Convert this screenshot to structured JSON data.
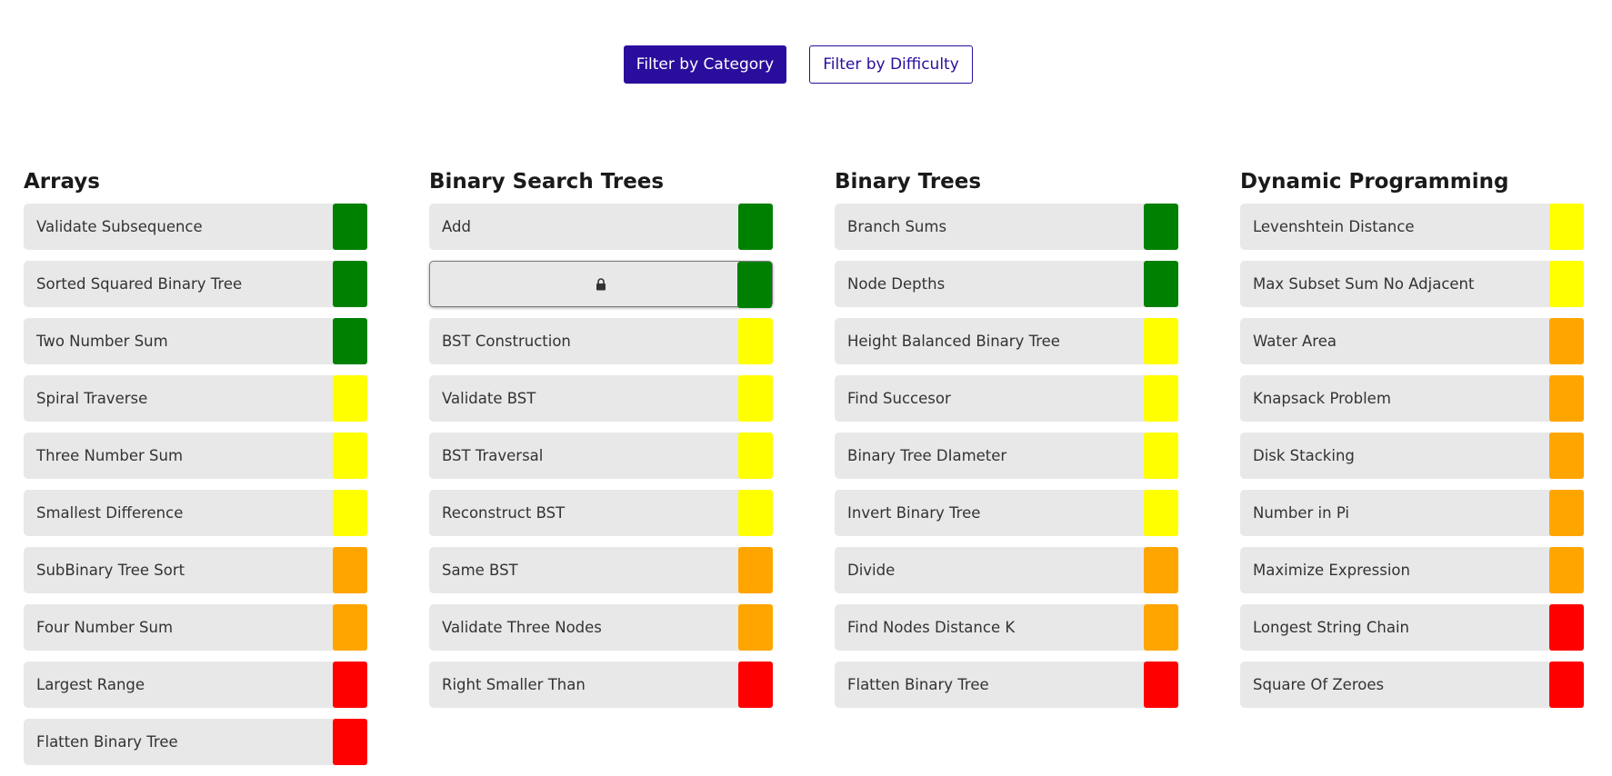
{
  "filters": {
    "category_label": "Filter by Category",
    "difficulty_label": "Filter by Difficulty"
  },
  "difficulty_colors": {
    "easy": "#008000",
    "medium": "#ffff00",
    "hard": "#ffa500",
    "very_hard": "#ff0000"
  },
  "categories": [
    {
      "title": "Arrays",
      "items": [
        {
          "label": "Validate Subsequence",
          "difficulty": "easy"
        },
        {
          "label": "Sorted Squared Binary Tree",
          "difficulty": "easy"
        },
        {
          "label": "Two Number Sum",
          "difficulty": "easy"
        },
        {
          "label": "Spiral Traverse",
          "difficulty": "medium"
        },
        {
          "label": "Three Number Sum",
          "difficulty": "medium"
        },
        {
          "label": "Smallest Difference",
          "difficulty": "medium"
        },
        {
          "label": "SubBinary Tree Sort",
          "difficulty": "hard"
        },
        {
          "label": "Four Number Sum",
          "difficulty": "hard"
        },
        {
          "label": "Largest Range",
          "difficulty": "very_hard"
        },
        {
          "label": "Flatten Binary Tree",
          "difficulty": "very_hard"
        }
      ]
    },
    {
      "title": "Binary Search Trees",
      "items": [
        {
          "label": "Add",
          "difficulty": "easy"
        },
        {
          "label": "",
          "difficulty": "easy",
          "locked": true,
          "icon": "lock-icon"
        },
        {
          "label": "BST Construction",
          "difficulty": "medium"
        },
        {
          "label": "Validate BST",
          "difficulty": "medium"
        },
        {
          "label": "BST Traversal",
          "difficulty": "medium"
        },
        {
          "label": "Reconstruct BST",
          "difficulty": "medium"
        },
        {
          "label": "Same BST",
          "difficulty": "hard"
        },
        {
          "label": "Validate Three Nodes",
          "difficulty": "hard"
        },
        {
          "label": "Right Smaller Than",
          "difficulty": "very_hard"
        }
      ]
    },
    {
      "title": "Binary Trees",
      "items": [
        {
          "label": "Branch Sums",
          "difficulty": "easy"
        },
        {
          "label": "Node Depths",
          "difficulty": "easy"
        },
        {
          "label": "Height Balanced Binary Tree",
          "difficulty": "medium"
        },
        {
          "label": "Find Succesor",
          "difficulty": "medium"
        },
        {
          "label": "Binary Tree DIameter",
          "difficulty": "medium"
        },
        {
          "label": "Invert Binary Tree",
          "difficulty": "medium"
        },
        {
          "label": "Divide",
          "difficulty": "hard"
        },
        {
          "label": "Find Nodes Distance K",
          "difficulty": "hard"
        },
        {
          "label": "Flatten Binary Tree",
          "difficulty": "very_hard"
        }
      ]
    },
    {
      "title": "Dynamic Programming",
      "items": [
        {
          "label": "Levenshtein Distance",
          "difficulty": "medium"
        },
        {
          "label": "Max Subset Sum No Adjacent",
          "difficulty": "medium"
        },
        {
          "label": "Water Area",
          "difficulty": "hard"
        },
        {
          "label": "Knapsack Problem",
          "difficulty": "hard"
        },
        {
          "label": "Disk Stacking",
          "difficulty": "hard"
        },
        {
          "label": "Number in Pi",
          "difficulty": "hard"
        },
        {
          "label": "Maximize Expression",
          "difficulty": "hard"
        },
        {
          "label": "Longest String Chain",
          "difficulty": "very_hard"
        },
        {
          "label": "Square Of Zeroes",
          "difficulty": "very_hard"
        }
      ]
    }
  ]
}
